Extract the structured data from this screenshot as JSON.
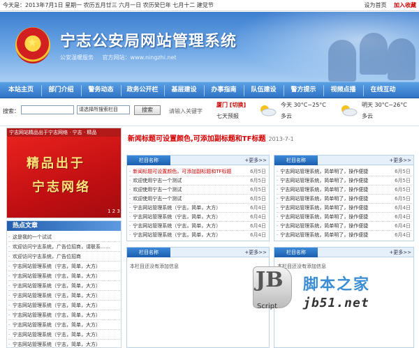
{
  "topbar": {
    "date_text": "今天是：2013年7月1日 星期一 农历五月廿三 六月一日 农历癸巳年 七月十二 建党节",
    "links": [
      "设为首页",
      "加入收藏"
    ]
  },
  "banner": {
    "title": "宁志公安局网站管理系统",
    "subtitle": [
      "公安温暖服务",
      "官方网站：www.ningzhi.net"
    ]
  },
  "nav": [
    "本站主页",
    "部门介绍",
    "警务动态",
    "政务公开栏",
    "基层建设",
    "办事指南",
    "队伍建设",
    "警方提示",
    "视频点播",
    "在线互动"
  ],
  "search": {
    "label": "搜索：",
    "placeholder": "",
    "select_value": "请选择所搜索栏目",
    "button_label": "搜索",
    "hint": "请输入关键字"
  },
  "weather": {
    "city": "厦门 [切换]",
    "index": "七天预报",
    "today_label": "今天",
    "today_temp": "30°C~25°C",
    "today_desc": "多云",
    "tomorrow_label": "明天",
    "tomorrow_temp": "30°C~26°C",
    "tomorrow_desc": "多云"
  },
  "feature": {
    "header": "宁志网站精品出于宁志网络 · 宁志 · 精品",
    "line1": "精品出于",
    "line2": "宁志网络",
    "dots": "1 2 3"
  },
  "hot": {
    "title": "热点文章",
    "items": [
      "这是我的一个试试",
      "欢迎访问宁志系统，广告位招商，请联系……",
      "欢迎访问宁志系统，广告位招商",
      "宁志网站管理系统（宁志，简单，大方）",
      "宁志网站管理系统（宁志，简单，大方）",
      "宁志网站管理系统（宁志，简单，大方）",
      "宁志网站管理系统（宁志，简单，大方）",
      "宁志网站管理系统（宁志，简单，大方）",
      "宁志网站管理系统（宁志，简单，大方）",
      "宁志网站管理系统（宁志，简单，大方）",
      "宁志网站管理系统（宁志，简单，大方）",
      "宁志网站管理系统（宁志，简单，大方）"
    ]
  },
  "headline": {
    "text": "新闻标题可设置颜色,可添加副标题和TF标题",
    "date": "2013-7-1"
  },
  "panels": {
    "p1": {
      "tab": "栏目名称",
      "more": "+更多>>",
      "rows": [
        {
          "t": "新闻标题可设置颜色，可添加副标题和TF标题",
          "d": "6月5日",
          "red": true
        },
        {
          "t": "欢迎使用宁志一个测试",
          "d": "6月5日",
          "red": false
        },
        {
          "t": "欢迎使用宁志一个测试",
          "d": "6月5日",
          "red": false
        },
        {
          "t": "欢迎使用宁志一个测试",
          "d": "6月5日",
          "red": false
        },
        {
          "t": "宁志网站管理系统（宁志，简单，大方）",
          "d": "6月4日",
          "red": false
        },
        {
          "t": "宁志网站管理系统（宁志，简单，大方）",
          "d": "6月4日",
          "red": false
        },
        {
          "t": "宁志网站管理系统（宁志，简单，大方）",
          "d": "6月4日",
          "red": false
        },
        {
          "t": "宁志网站管理系统（宁志，简单，大方）",
          "d": "6月4日",
          "red": false
        }
      ]
    },
    "p2": {
      "tab": "栏目名称",
      "more": "+更多>>",
      "rows": [
        {
          "t": "宁志网站管理系统，简单明了，操作便捷",
          "d": "6月5日"
        },
        {
          "t": "宁志网站管理系统，简单明了，操作便捷",
          "d": "6月5日"
        },
        {
          "t": "宁志网站管理系统，简单明了，操作便捷",
          "d": "6月5日"
        },
        {
          "t": "宁志网站管理系统，简单明了，操作便捷",
          "d": "6月5日"
        },
        {
          "t": "宁志网站管理系统，简单明了，操作便捷",
          "d": "6月4日"
        },
        {
          "t": "宁志网站管理系统，简单明了，操作便捷",
          "d": "6月4日"
        },
        {
          "t": "宁志网站管理系统，简单明了，操作便捷",
          "d": "6月4日"
        },
        {
          "t": "宁志网站管理系统，简单明了，操作便捷",
          "d": "6月4日"
        }
      ]
    },
    "p3": {
      "tab": "栏目名称",
      "more": "+更多>>",
      "empty": "本栏目还没有添加信息"
    },
    "p4": {
      "tab": "栏目名称",
      "more": "+更多>>",
      "empty": "本栏目还没有添加信息"
    }
  },
  "watermark": {
    "cn": "脚本之家",
    "en": "jb51.net",
    "script": "Script",
    "jb": "JB"
  },
  "colors": {
    "nav": "#2f73c6",
    "accent": "#d40000",
    "panel_head": "#1d5fb0"
  }
}
